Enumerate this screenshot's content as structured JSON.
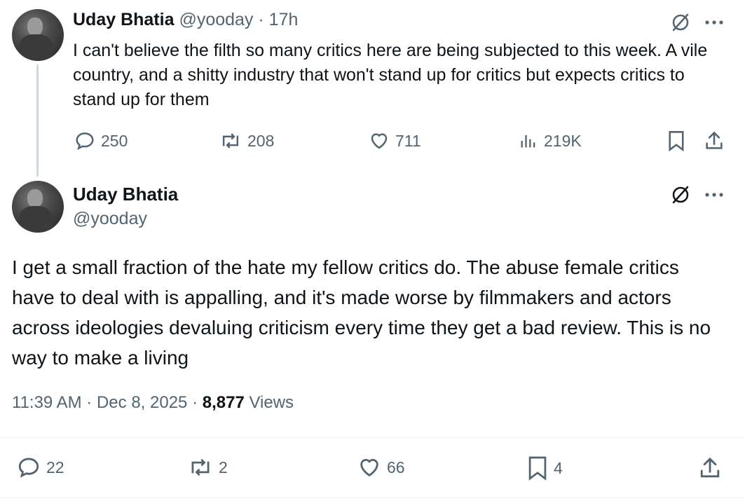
{
  "reply_tweet": {
    "display_name": "Uday Bhatia",
    "handle": "@yooday",
    "separator": "·",
    "time_ago": "17h",
    "text": "I can't believe the filth so many critics here are being subjected to this week. A vile country, and a shitty industry that won't stand up for critics but expects critics to stand up for them",
    "replies": "250",
    "reposts": "208",
    "likes": "711",
    "views": "219K"
  },
  "main_tweet": {
    "display_name": "Uday Bhatia",
    "handle": "@yooday",
    "text": "I get a small fraction of the hate my fellow critics do. The abuse female critics have to deal with is appalling, and it's made worse by filmmakers and actors across ideologies devaluing criticism every time they get a bad review. This is no way to make a living",
    "time": "11:39 AM",
    "date": "Dec 8, 2025",
    "separator": "·",
    "view_count": "8,877",
    "views_label": "Views",
    "replies": "22",
    "reposts": "2",
    "likes": "66",
    "bookmarks": "4"
  },
  "icons": {
    "grok": "grok-icon",
    "more": "more-icon",
    "reply": "reply-icon",
    "repost": "repost-icon",
    "like": "like-icon",
    "views": "views-icon",
    "bookmark": "bookmark-icon",
    "share": "share-icon"
  },
  "colors": {
    "text": "#0f1419",
    "muted": "#536471",
    "thread_line": "#cfd9de",
    "divider": "#eff3f4"
  }
}
